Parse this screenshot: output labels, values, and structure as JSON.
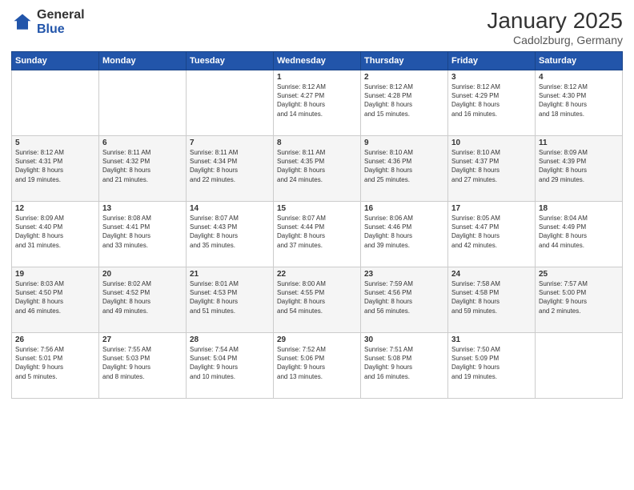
{
  "logo": {
    "general": "General",
    "blue": "Blue"
  },
  "header": {
    "title": "January 2025",
    "subtitle": "Cadolzburg, Germany"
  },
  "weekdays": [
    "Sunday",
    "Monday",
    "Tuesday",
    "Wednesday",
    "Thursday",
    "Friday",
    "Saturday"
  ],
  "weeks": [
    [
      {
        "day": "",
        "info": ""
      },
      {
        "day": "",
        "info": ""
      },
      {
        "day": "",
        "info": ""
      },
      {
        "day": "1",
        "info": "Sunrise: 8:12 AM\nSunset: 4:27 PM\nDaylight: 8 hours\nand 14 minutes."
      },
      {
        "day": "2",
        "info": "Sunrise: 8:12 AM\nSunset: 4:28 PM\nDaylight: 8 hours\nand 15 minutes."
      },
      {
        "day": "3",
        "info": "Sunrise: 8:12 AM\nSunset: 4:29 PM\nDaylight: 8 hours\nand 16 minutes."
      },
      {
        "day": "4",
        "info": "Sunrise: 8:12 AM\nSunset: 4:30 PM\nDaylight: 8 hours\nand 18 minutes."
      }
    ],
    [
      {
        "day": "5",
        "info": "Sunrise: 8:12 AM\nSunset: 4:31 PM\nDaylight: 8 hours\nand 19 minutes."
      },
      {
        "day": "6",
        "info": "Sunrise: 8:11 AM\nSunset: 4:32 PM\nDaylight: 8 hours\nand 21 minutes."
      },
      {
        "day": "7",
        "info": "Sunrise: 8:11 AM\nSunset: 4:34 PM\nDaylight: 8 hours\nand 22 minutes."
      },
      {
        "day": "8",
        "info": "Sunrise: 8:11 AM\nSunset: 4:35 PM\nDaylight: 8 hours\nand 24 minutes."
      },
      {
        "day": "9",
        "info": "Sunrise: 8:10 AM\nSunset: 4:36 PM\nDaylight: 8 hours\nand 25 minutes."
      },
      {
        "day": "10",
        "info": "Sunrise: 8:10 AM\nSunset: 4:37 PM\nDaylight: 8 hours\nand 27 minutes."
      },
      {
        "day": "11",
        "info": "Sunrise: 8:09 AM\nSunset: 4:39 PM\nDaylight: 8 hours\nand 29 minutes."
      }
    ],
    [
      {
        "day": "12",
        "info": "Sunrise: 8:09 AM\nSunset: 4:40 PM\nDaylight: 8 hours\nand 31 minutes."
      },
      {
        "day": "13",
        "info": "Sunrise: 8:08 AM\nSunset: 4:41 PM\nDaylight: 8 hours\nand 33 minutes."
      },
      {
        "day": "14",
        "info": "Sunrise: 8:07 AM\nSunset: 4:43 PM\nDaylight: 8 hours\nand 35 minutes."
      },
      {
        "day": "15",
        "info": "Sunrise: 8:07 AM\nSunset: 4:44 PM\nDaylight: 8 hours\nand 37 minutes."
      },
      {
        "day": "16",
        "info": "Sunrise: 8:06 AM\nSunset: 4:46 PM\nDaylight: 8 hours\nand 39 minutes."
      },
      {
        "day": "17",
        "info": "Sunrise: 8:05 AM\nSunset: 4:47 PM\nDaylight: 8 hours\nand 42 minutes."
      },
      {
        "day": "18",
        "info": "Sunrise: 8:04 AM\nSunset: 4:49 PM\nDaylight: 8 hours\nand 44 minutes."
      }
    ],
    [
      {
        "day": "19",
        "info": "Sunrise: 8:03 AM\nSunset: 4:50 PM\nDaylight: 8 hours\nand 46 minutes."
      },
      {
        "day": "20",
        "info": "Sunrise: 8:02 AM\nSunset: 4:52 PM\nDaylight: 8 hours\nand 49 minutes."
      },
      {
        "day": "21",
        "info": "Sunrise: 8:01 AM\nSunset: 4:53 PM\nDaylight: 8 hours\nand 51 minutes."
      },
      {
        "day": "22",
        "info": "Sunrise: 8:00 AM\nSunset: 4:55 PM\nDaylight: 8 hours\nand 54 minutes."
      },
      {
        "day": "23",
        "info": "Sunrise: 7:59 AM\nSunset: 4:56 PM\nDaylight: 8 hours\nand 56 minutes."
      },
      {
        "day": "24",
        "info": "Sunrise: 7:58 AM\nSunset: 4:58 PM\nDaylight: 8 hours\nand 59 minutes."
      },
      {
        "day": "25",
        "info": "Sunrise: 7:57 AM\nSunset: 5:00 PM\nDaylight: 9 hours\nand 2 minutes."
      }
    ],
    [
      {
        "day": "26",
        "info": "Sunrise: 7:56 AM\nSunset: 5:01 PM\nDaylight: 9 hours\nand 5 minutes."
      },
      {
        "day": "27",
        "info": "Sunrise: 7:55 AM\nSunset: 5:03 PM\nDaylight: 9 hours\nand 8 minutes."
      },
      {
        "day": "28",
        "info": "Sunrise: 7:54 AM\nSunset: 5:04 PM\nDaylight: 9 hours\nand 10 minutes."
      },
      {
        "day": "29",
        "info": "Sunrise: 7:52 AM\nSunset: 5:06 PM\nDaylight: 9 hours\nand 13 minutes."
      },
      {
        "day": "30",
        "info": "Sunrise: 7:51 AM\nSunset: 5:08 PM\nDaylight: 9 hours\nand 16 minutes."
      },
      {
        "day": "31",
        "info": "Sunrise: 7:50 AM\nSunset: 5:09 PM\nDaylight: 9 hours\nand 19 minutes."
      },
      {
        "day": "",
        "info": ""
      }
    ]
  ]
}
